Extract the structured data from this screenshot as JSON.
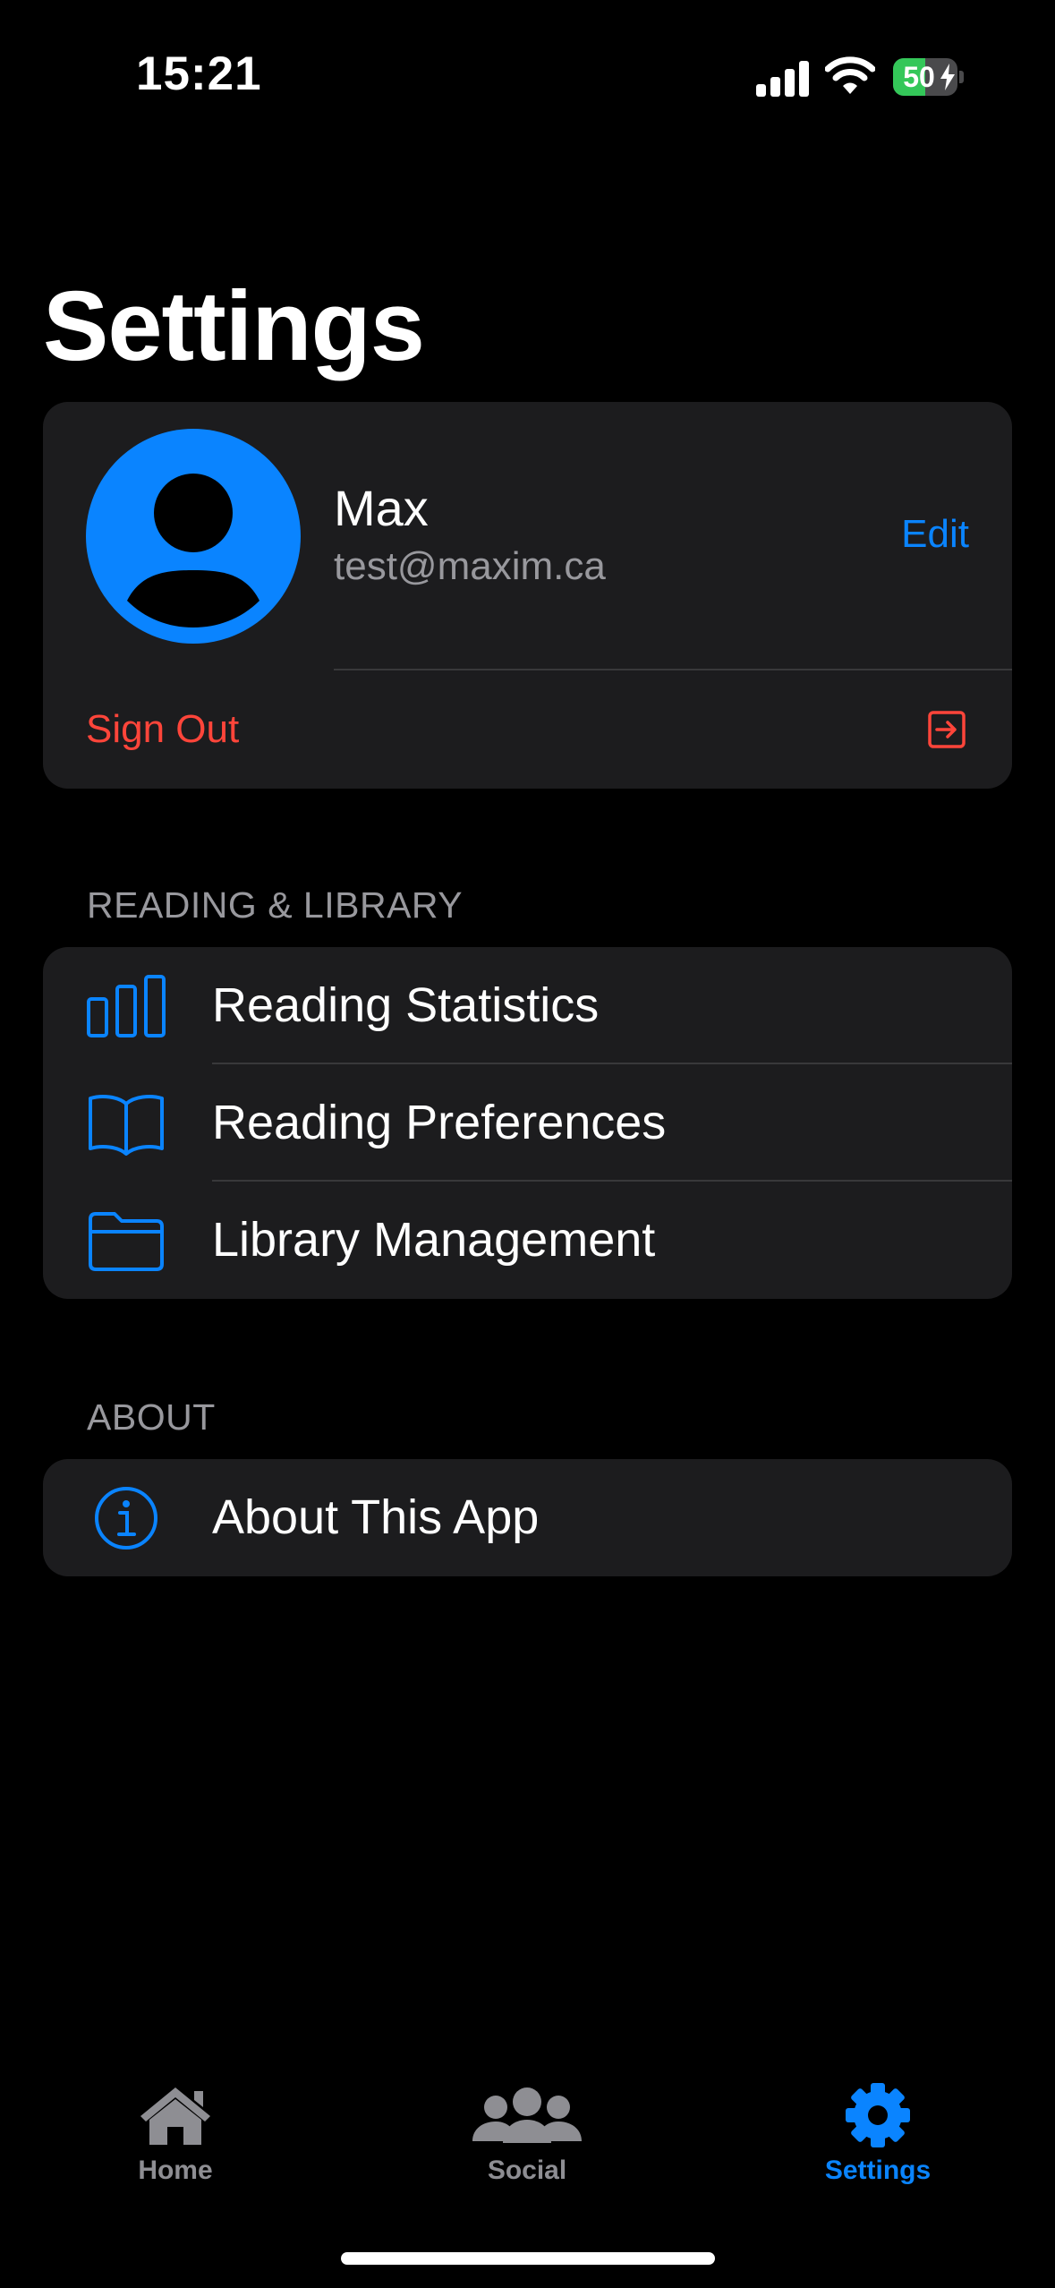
{
  "status_bar": {
    "time": "15:21",
    "battery_percent": "50",
    "battery_level": 0.5
  },
  "page": {
    "title": "Settings"
  },
  "profile": {
    "name": "Max",
    "email": "test@maxim.ca",
    "edit_label": "Edit",
    "sign_out_label": "Sign Out"
  },
  "sections": {
    "reading": {
      "header": "READING & LIBRARY",
      "items": [
        {
          "label": "Reading Statistics",
          "icon": "bar-chart-icon"
        },
        {
          "label": "Reading Preferences",
          "icon": "open-book-icon"
        },
        {
          "label": "Library Management",
          "icon": "folder-icon"
        }
      ]
    },
    "about": {
      "header": "ABOUT",
      "items": [
        {
          "label": "About This App",
          "icon": "info-circle-icon"
        }
      ]
    }
  },
  "tab_bar": {
    "tabs": [
      {
        "label": "Home",
        "icon": "house-icon",
        "active": false
      },
      {
        "label": "Social",
        "icon": "people-icon",
        "active": false
      },
      {
        "label": "Settings",
        "icon": "gear-icon",
        "active": true
      }
    ]
  },
  "colors": {
    "accent": "#0a84ff",
    "destructive": "#ff453a",
    "card_background": "#1c1c1e",
    "secondary_text": "#98989d",
    "inactive_tab": "#8e8e93",
    "battery_green": "#34c759"
  }
}
